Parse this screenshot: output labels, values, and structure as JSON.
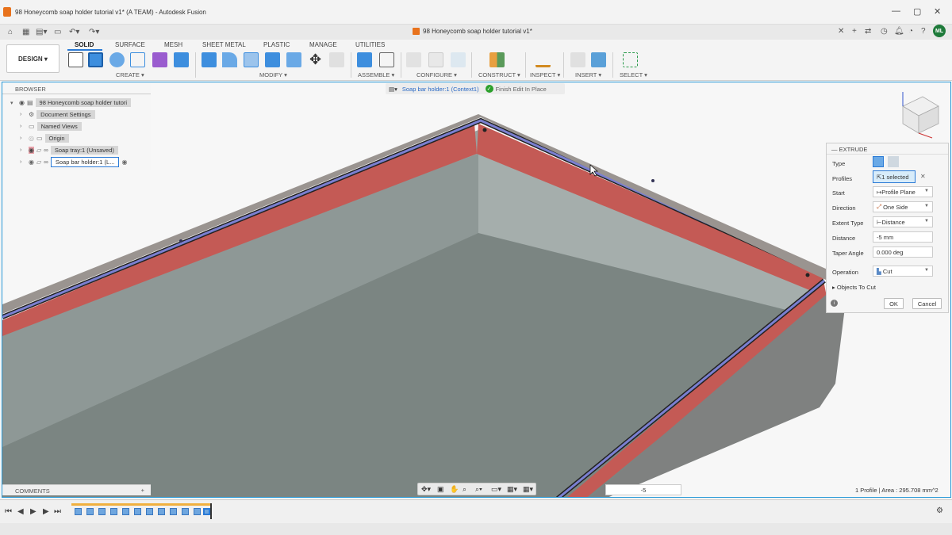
{
  "window": {
    "title": "98 Honeycomb soap holder tutorial v1* (A TEAM) - Autodesk Fusion",
    "doc_tab": "98 Honeycomb soap holder tutorial v1*",
    "user_initials": "ML"
  },
  "toolbar": {
    "workspace": "DESIGN ▾",
    "tabs": [
      "SOLID",
      "SURFACE",
      "MESH",
      "SHEET METAL",
      "PLASTIC",
      "MANAGE",
      "UTILITIES"
    ],
    "groups": [
      "CREATE ▾",
      "MODIFY ▾",
      "ASSEMBLE ▾",
      "CONFIGURE ▾",
      "CONSTRUCT ▾",
      "INSPECT ▾",
      "INSERT ▾",
      "SELECT ▾"
    ]
  },
  "browser": {
    "header": "BROWSER",
    "items": [
      {
        "label": "98 Honeycomb soap holder tutori"
      },
      {
        "label": "Document Settings"
      },
      {
        "label": "Named Views"
      },
      {
        "label": "Origin"
      },
      {
        "label": "Soap tray:1 (Unsaved)"
      },
      {
        "label": "Soap bar holder:1 (L..."
      }
    ]
  },
  "context": {
    "component": "Soap bar holder:1 (Context1)",
    "finish": "Finish Edit In Place"
  },
  "extrude": {
    "title": "EXTRUDE",
    "type_label": "Type",
    "profiles_label": "Profiles",
    "profiles_value": "1 selected",
    "start_label": "Start",
    "start_value": "Profile Plane",
    "direction_label": "Direction",
    "direction_value": "One Side",
    "extent_label": "Extent Type",
    "extent_value": "Distance",
    "distance_label": "Distance",
    "distance_value": "-5 mm",
    "taper_label": "Taper Angle",
    "taper_value": "0.000 deg",
    "operation_label": "Operation",
    "operation_value": "Cut",
    "objects_label": "Objects To Cut",
    "ok": "OK",
    "cancel": "Cancel"
  },
  "comments": "COMMENTS",
  "distance_input": "-5",
  "status": "1 Profile | Area : 295.708 mm^2",
  "colors": {
    "accent": "#2a9ad8",
    "cut_face": "#c0504d",
    "selection": "#6a6fc0",
    "fusion_orange": "#e8721c"
  }
}
